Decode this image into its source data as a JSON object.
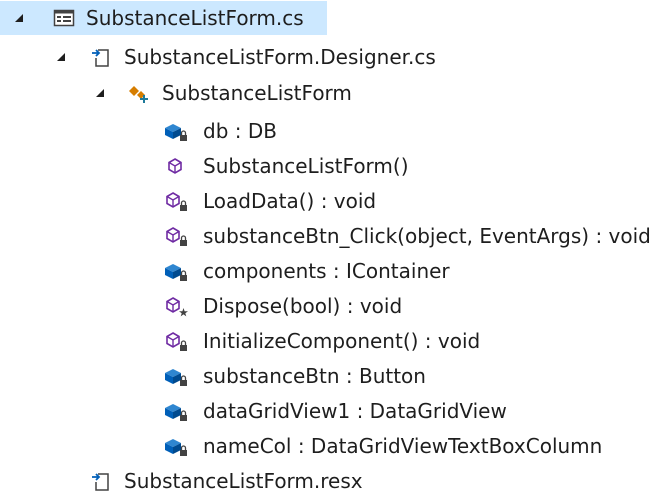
{
  "tree": {
    "rows": [
      {
        "label": "SubstanceListForm.cs",
        "icon": "form-file-icon",
        "expanded": true,
        "selected": true
      },
      {
        "label": "SubstanceListForm.Designer.cs",
        "icon": "designer-file-icon",
        "expanded": true
      },
      {
        "label": "SubstanceListForm",
        "icon": "class-icon",
        "expanded": true
      },
      {
        "label": "db : DB",
        "icon": "private-field-icon"
      },
      {
        "label": "SubstanceListForm()",
        "icon": "public-method-icon"
      },
      {
        "label": "LoadData() : void",
        "icon": "private-method-icon"
      },
      {
        "label": "substanceBtn_Click(object, EventArgs) : void",
        "icon": "private-method-icon"
      },
      {
        "label": "components : IContainer",
        "icon": "private-field-icon"
      },
      {
        "label": "Dispose(bool) : void",
        "icon": "protected-override-method-icon"
      },
      {
        "label": "InitializeComponent() : void",
        "icon": "private-method-icon"
      },
      {
        "label": "substanceBtn : Button",
        "icon": "private-field-icon"
      },
      {
        "label": "dataGridView1 : DataGridView",
        "icon": "private-field-icon"
      },
      {
        "label": "nameCol : DataGridViewTextBoxColumn",
        "icon": "private-field-icon"
      },
      {
        "label": "SubstanceListForm.resx",
        "icon": "resx-file-icon"
      }
    ]
  },
  "colors": {
    "selection": "#cce8ff",
    "field_blue": "#005fb8",
    "method_purple": "#6f2ba3",
    "class_orange": "#d67d00"
  }
}
